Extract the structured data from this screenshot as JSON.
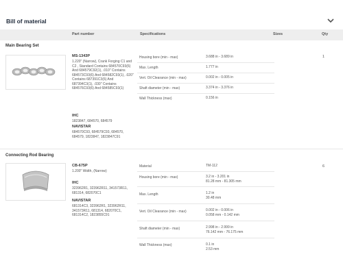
{
  "header": {
    "title": "Bill of material"
  },
  "columns": {
    "part_number": "Part number",
    "specifications": "Specifications",
    "sizes": "Sizes",
    "qty": "Qty"
  },
  "sections": [
    {
      "title": "Main Bearing Set",
      "part_number": "MS-1343P",
      "description": "1.220\" (Narrow), Crank Forging C1 and C2 , Standard Contains 684570C93(6) And 684579C92(1), .010\" Contains 684573C93(6) And 684582C93(1), .020\" Contains 687391C3(6) And 687394C3(1), .030\" Contains 684576C93(6) And 684585C93(1)",
      "ihc_label": "IHC",
      "ihc_numbers": "1823847, 684570, 684579",
      "navistar_label": "NAVISTAR",
      "navistar_numbers": "684570C93, 684579C93, 684570, 684579, 1823847, 1823847C91",
      "specs": [
        {
          "key": "Housing bore (min - max)",
          "value": "3.688 in - 3.689 in"
        },
        {
          "key": "Max. Length",
          "value": "1.777 in"
        },
        {
          "key": "Vert. Oil Clearance (min - max)",
          "value": "0.002 in - 0.005 in"
        },
        {
          "key": "Shaft diameter (min - max)",
          "value": "3.374 in - 3.376 in"
        },
        {
          "key": "Wall Thickness (max)",
          "value": "0.156 in"
        }
      ],
      "qty": "1"
    },
    {
      "title": "Connecting Rod Bearing",
      "part_number": "CB-675P",
      "description": "1.200\" Width, (Narrow)",
      "ihc_label": "IHC",
      "ihc_numbers": "323962R1, 323962R11, 341573R11, 681314, 682070C1",
      "navistar_label": "NAVISTAR",
      "navistar_numbers": "681314C3, 323962R1, 323962R11, 341573R11, 681314, 682070C1, 681314C2, 1823855C91",
      "specs": [
        {
          "key": "Material",
          "value": "TM-112"
        },
        {
          "key": "Housing bore (min - max)",
          "value": "3.2 in - 3.201 in",
          "value2": "81.28 mm - 81.305 mm"
        },
        {
          "key": "Max. Length",
          "value": "1.2 in",
          "value2": "30.48 mm"
        },
        {
          "key": "Vert. Oil Clearance (min - max)",
          "value": "0.002 in - 0.006 in",
          "value2": "0.058 mm - 0.142 mm"
        },
        {
          "key": "Shaft diameter (min - max)",
          "value": "2.998 in - 2.999 in",
          "value2": "76.142 mm - 76.175 mm"
        },
        {
          "key": "Wall Thickness (max)",
          "value": "0.1 in",
          "value2": "2.53 mm"
        }
      ],
      "qty": "6"
    }
  ]
}
